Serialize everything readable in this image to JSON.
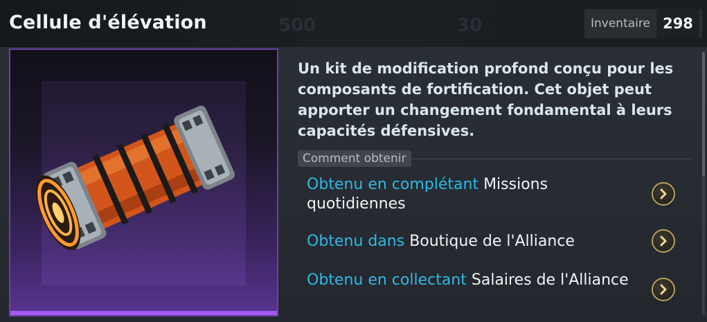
{
  "header": {
    "title": "Cellule d'élévation",
    "inventory_label": "Inventaire",
    "inventory_value": "298",
    "bg_numbers": [
      "500",
      "30"
    ]
  },
  "item": {
    "image_icon": "orange-energy-cell-icon",
    "rarity_color": "#a35bf0",
    "description": "Un kit de modification profond conçu pour les composants de fortification. Cet objet peut apporter un changement fondamental à leurs capacités défensives."
  },
  "how_to_obtain": {
    "label": "Comment obtenir",
    "sources": [
      {
        "highlight": "Obtenu en complétant",
        "text": "Missions quotidiennes",
        "icon": "chevron-right-icon"
      },
      {
        "highlight": "Obtenu dans",
        "text": "Boutique de l'Alliance",
        "icon": "chevron-right-icon"
      },
      {
        "highlight": "Obtenu en collectant",
        "text": "Salaires de l'Alliance",
        "icon": "chevron-right-icon"
      }
    ],
    "accent_color": "#2fb8e6"
  }
}
